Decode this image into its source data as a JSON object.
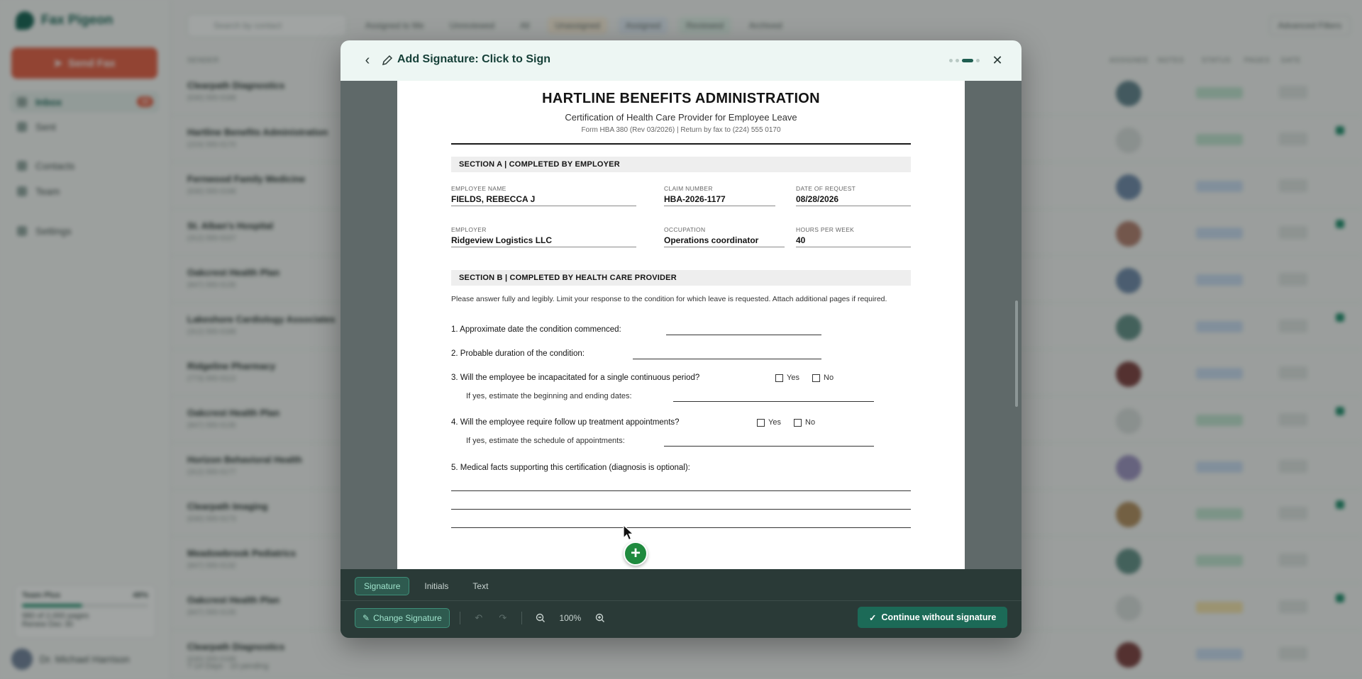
{
  "app": {
    "name": "Fax Pigeon",
    "send_fax": "Send Fax",
    "nav": [
      {
        "label": "Inbox",
        "badge": "12"
      },
      {
        "label": "Sent"
      },
      {
        "label": "Contacts"
      },
      {
        "label": "Team"
      },
      {
        "label": "Settings"
      }
    ],
    "plan": {
      "name": "Team Plus",
      "percent": "48%",
      "usage": "980 of 2,000 pages",
      "note": "Renew Dec 30"
    },
    "user": "Dr. Michael Harrison",
    "search_placeholder": "Search by contact",
    "filters": [
      "Assigned to Me",
      "Unreviewed",
      "All",
      "Unassigned",
      "Assigned",
      "Reviewed",
      "Archived"
    ],
    "advanced_filters": "Advanced Filters",
    "columns": [
      "SENDER",
      "ASSIGNEE",
      "NOTES",
      "STATUS",
      "PAGES",
      "DATE"
    ],
    "rows": [
      {
        "name": "Clearpath Diagnostics",
        "phone": "(630) 555-0188"
      },
      {
        "name": "Hartline Benefits Administration",
        "phone": "(224) 555-0170"
      },
      {
        "name": "Fernwood Family Medicine",
        "phone": "(630) 555-0198"
      },
      {
        "name": "St. Alban's Hospital",
        "phone": "(312) 555-0107"
      },
      {
        "name": "Oakcrest Health Plan",
        "phone": "(847) 555-0135"
      },
      {
        "name": "Lakeshore Cardiology Associates",
        "phone": "(312) 555-0188"
      },
      {
        "name": "Ridgeline Pharmacy",
        "phone": "(773) 555-0113"
      },
      {
        "name": "Oakcrest Health Plan",
        "phone": "(847) 555-0135"
      },
      {
        "name": "Horizon Behavioral Health",
        "phone": "(312) 555-0177"
      },
      {
        "name": "Clearpath Imaging",
        "phone": "(630) 555-0173"
      },
      {
        "name": "Meadowbrook Pediatrics",
        "phone": "(847) 555-0132"
      },
      {
        "name": "Oakcrest Health Plan",
        "phone": "(847) 555-0135"
      },
      {
        "name": "Clearpath Diagnostics",
        "phone": "(630) 555-0188"
      }
    ],
    "footer_note": "7-14 Days · 10 pending"
  },
  "modal": {
    "title": "Add Signature: Click to Sign",
    "footer": {
      "tabs": [
        "Signature",
        "Initials",
        "Text"
      ],
      "change_signature": "Change Signature",
      "zoom": "100%",
      "continue": "Continue without signature"
    }
  },
  "document": {
    "title": "HARTLINE BENEFITS ADMINISTRATION",
    "subtitle": "Certification of Health Care Provider for Employee Leave",
    "form_line": "Form HBA 380 (Rev 03/2026)  |  Return by fax to (224) 555 0170",
    "section_a": "SECTION A  |  COMPLETED BY EMPLOYER",
    "fields": {
      "employee_name": {
        "label": "EMPLOYEE NAME",
        "value": "FIELDS, REBECCA J"
      },
      "claim_number": {
        "label": "CLAIM NUMBER",
        "value": "HBA-2026-1177"
      },
      "date_of_request": {
        "label": "DATE OF REQUEST",
        "value": "08/28/2026"
      },
      "employer": {
        "label": "EMPLOYER",
        "value": "Ridgeview Logistics LLC"
      },
      "occupation": {
        "label": "OCCUPATION",
        "value": "Operations coordinator"
      },
      "hours_per_week": {
        "label": "HOURS PER WEEK",
        "value": "40"
      }
    },
    "section_b": "SECTION B  |  COMPLETED BY HEALTH CARE PROVIDER",
    "intro": "Please answer fully and legibly. Limit your response to the condition for which leave is requested. Attach additional pages if required.",
    "questions": {
      "q1": "1.  Approximate date the condition commenced:",
      "q2": "2.  Probable duration of the condition:",
      "q3": "3.  Will the employee be incapacitated for a single continuous period?",
      "q3_sub": "If yes, estimate the beginning and ending dates:",
      "q4": "4.  Will the employee require follow up treatment appointments?",
      "q4_sub": "If yes, estimate the schedule of appointments:",
      "q5": "5.  Medical facts supporting this certification (diagnosis is optional):",
      "yes": "Yes",
      "no": "No"
    }
  },
  "colors": {
    "accent": "#1c6a57",
    "send_fax": "#e55a3f",
    "add_button": "#1f8a3e",
    "footer_bg": "#2a3a37"
  }
}
